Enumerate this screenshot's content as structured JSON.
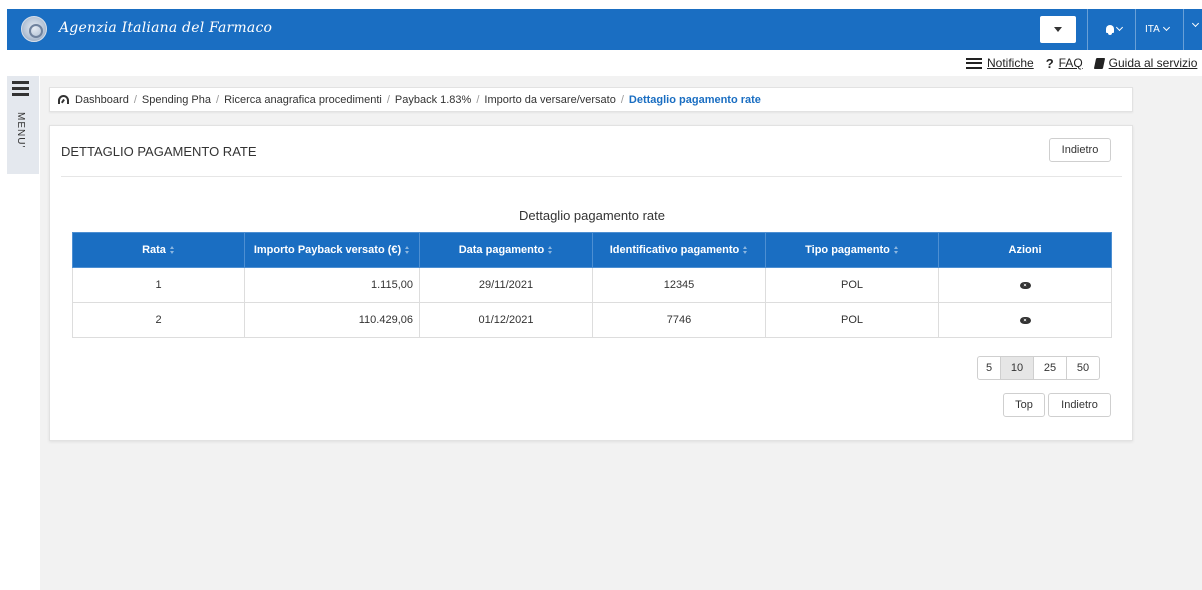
{
  "header": {
    "logo_text": "Agenzia Italiana del Farmaco",
    "language": "ITA"
  },
  "help_links": {
    "notifications": "Notifiche",
    "faq": "FAQ",
    "guide": "Guida al servizio"
  },
  "side_menu": {
    "label": "MENU'"
  },
  "breadcrumb": {
    "items": [
      "Dashboard",
      "Spending Pha",
      "Ricerca anagrafica procedimenti",
      "Payback 1.83%",
      "Importo da versare/versato"
    ],
    "active": "Dettaglio pagamento rate",
    "separator": "/"
  },
  "panel": {
    "title": "DETTAGLIO PAGAMENTO RATE",
    "back_label": "Indietro",
    "table_caption": "Dettaglio pagamento rate"
  },
  "table": {
    "columns": [
      "Rata",
      "Importo Payback versato (€)",
      "Data pagamento",
      "Identificativo pagamento",
      "Tipo pagamento",
      "Azioni"
    ],
    "rows": [
      {
        "rata": "1",
        "importo": "1.115,00",
        "data": "29/11/2021",
        "id": "12345",
        "tipo": "POL"
      },
      {
        "rata": "2",
        "importo": "110.429,06",
        "data": "01/12/2021",
        "id": "7746",
        "tipo": "POL"
      }
    ]
  },
  "pagination": {
    "sizes": [
      "5",
      "10",
      "25",
      "50"
    ],
    "selected": "10"
  },
  "footer_buttons": {
    "top": "Top",
    "back": "Indietro"
  },
  "colors": {
    "primary": "#1a6ec2",
    "background": "#f2f2f2"
  }
}
